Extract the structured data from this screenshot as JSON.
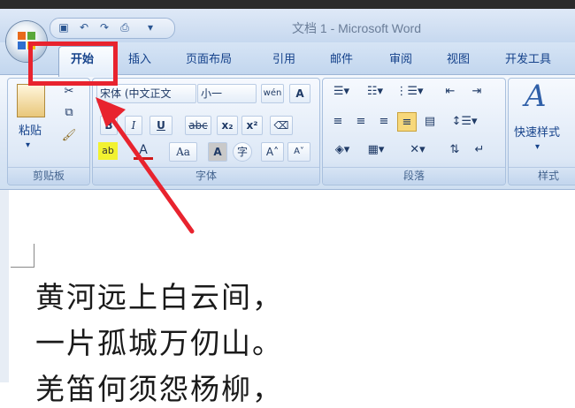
{
  "window": {
    "title": "文档 1 - Microsoft Word"
  },
  "tabs": [
    {
      "label": "开始",
      "active": true
    },
    {
      "label": "插入"
    },
    {
      "label": "页面布局"
    },
    {
      "label": "引用"
    },
    {
      "label": "邮件"
    },
    {
      "label": "审阅"
    },
    {
      "label": "视图"
    },
    {
      "label": "开发工具"
    }
  ],
  "clipboard": {
    "paste": "粘贴",
    "group": "剪贴板"
  },
  "font": {
    "name": "宋体 (中文正文",
    "size": "小一",
    "phonetic": "wén",
    "border_char": "A",
    "bold": "B",
    "italic": "I",
    "underline": "U",
    "strike": "abc",
    "sub": "x₂",
    "sup": "x²",
    "clear": "Aa",
    "shade_char": "A",
    "enclose": "字",
    "grow": "A˄",
    "shrink": "A˅",
    "group": "字体"
  },
  "paragraph": {
    "group": "段落"
  },
  "styles": {
    "quick": "快速样式",
    "group": "样式"
  },
  "document": {
    "lines": [
      "黄河远上白云间，",
      "一片孤城万仞山。",
      "羌笛何须怨杨柳，"
    ]
  },
  "annotation": {
    "color": "#e8232e"
  }
}
